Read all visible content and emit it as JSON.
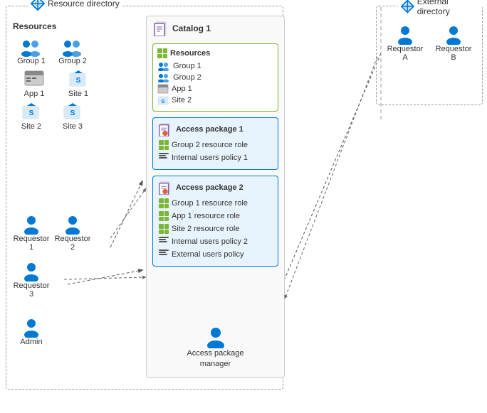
{
  "resourceDirectory": {
    "label": "Resource directory",
    "resources": {
      "title": "Resources",
      "items": [
        {
          "name": "Group 1",
          "type": "group"
        },
        {
          "name": "Group 2",
          "type": "group"
        },
        {
          "name": "App 1",
          "type": "app"
        },
        {
          "name": "Site 1",
          "type": "site"
        },
        {
          "name": "Site 2",
          "type": "site"
        },
        {
          "name": "Site 3",
          "type": "site"
        }
      ]
    },
    "requestors": [
      {
        "name": "Requestor 1",
        "type": "user"
      },
      {
        "name": "Requestor 2",
        "type": "user"
      },
      {
        "name": "Requestor 3",
        "type": "user"
      }
    ],
    "admin": {
      "name": "Admin",
      "type": "user"
    }
  },
  "externalDirectory": {
    "label": "External directory",
    "requestors": [
      {
        "name": "Requestor A",
        "type": "user"
      },
      {
        "name": "Requestor B",
        "type": "user"
      }
    ]
  },
  "catalog": {
    "label": "Catalog 1",
    "resources": {
      "title": "Resources",
      "items": [
        {
          "name": "Group 1",
          "type": "group"
        },
        {
          "name": "App 1",
          "type": "app"
        },
        {
          "name": "Group 2",
          "type": "group"
        },
        {
          "name": "Site 2",
          "type": "site"
        }
      ]
    },
    "accessPackages": [
      {
        "label": "Access package 1",
        "items": [
          {
            "text": "Group 2 resource role",
            "type": "resource"
          },
          {
            "text": "Internal users policy 1",
            "type": "policy"
          }
        ]
      },
      {
        "label": "Access package 2",
        "items": [
          {
            "text": "Group 1 resource role",
            "type": "resource"
          },
          {
            "text": "App 1 resource role",
            "type": "resource"
          },
          {
            "text": "Site 2 resource role",
            "type": "resource"
          },
          {
            "text": "Internal users policy 2",
            "type": "policy"
          },
          {
            "text": "External users policy",
            "type": "policy"
          }
        ]
      }
    ]
  },
  "accessPackageManager": {
    "label": "Access package\nmanager"
  }
}
